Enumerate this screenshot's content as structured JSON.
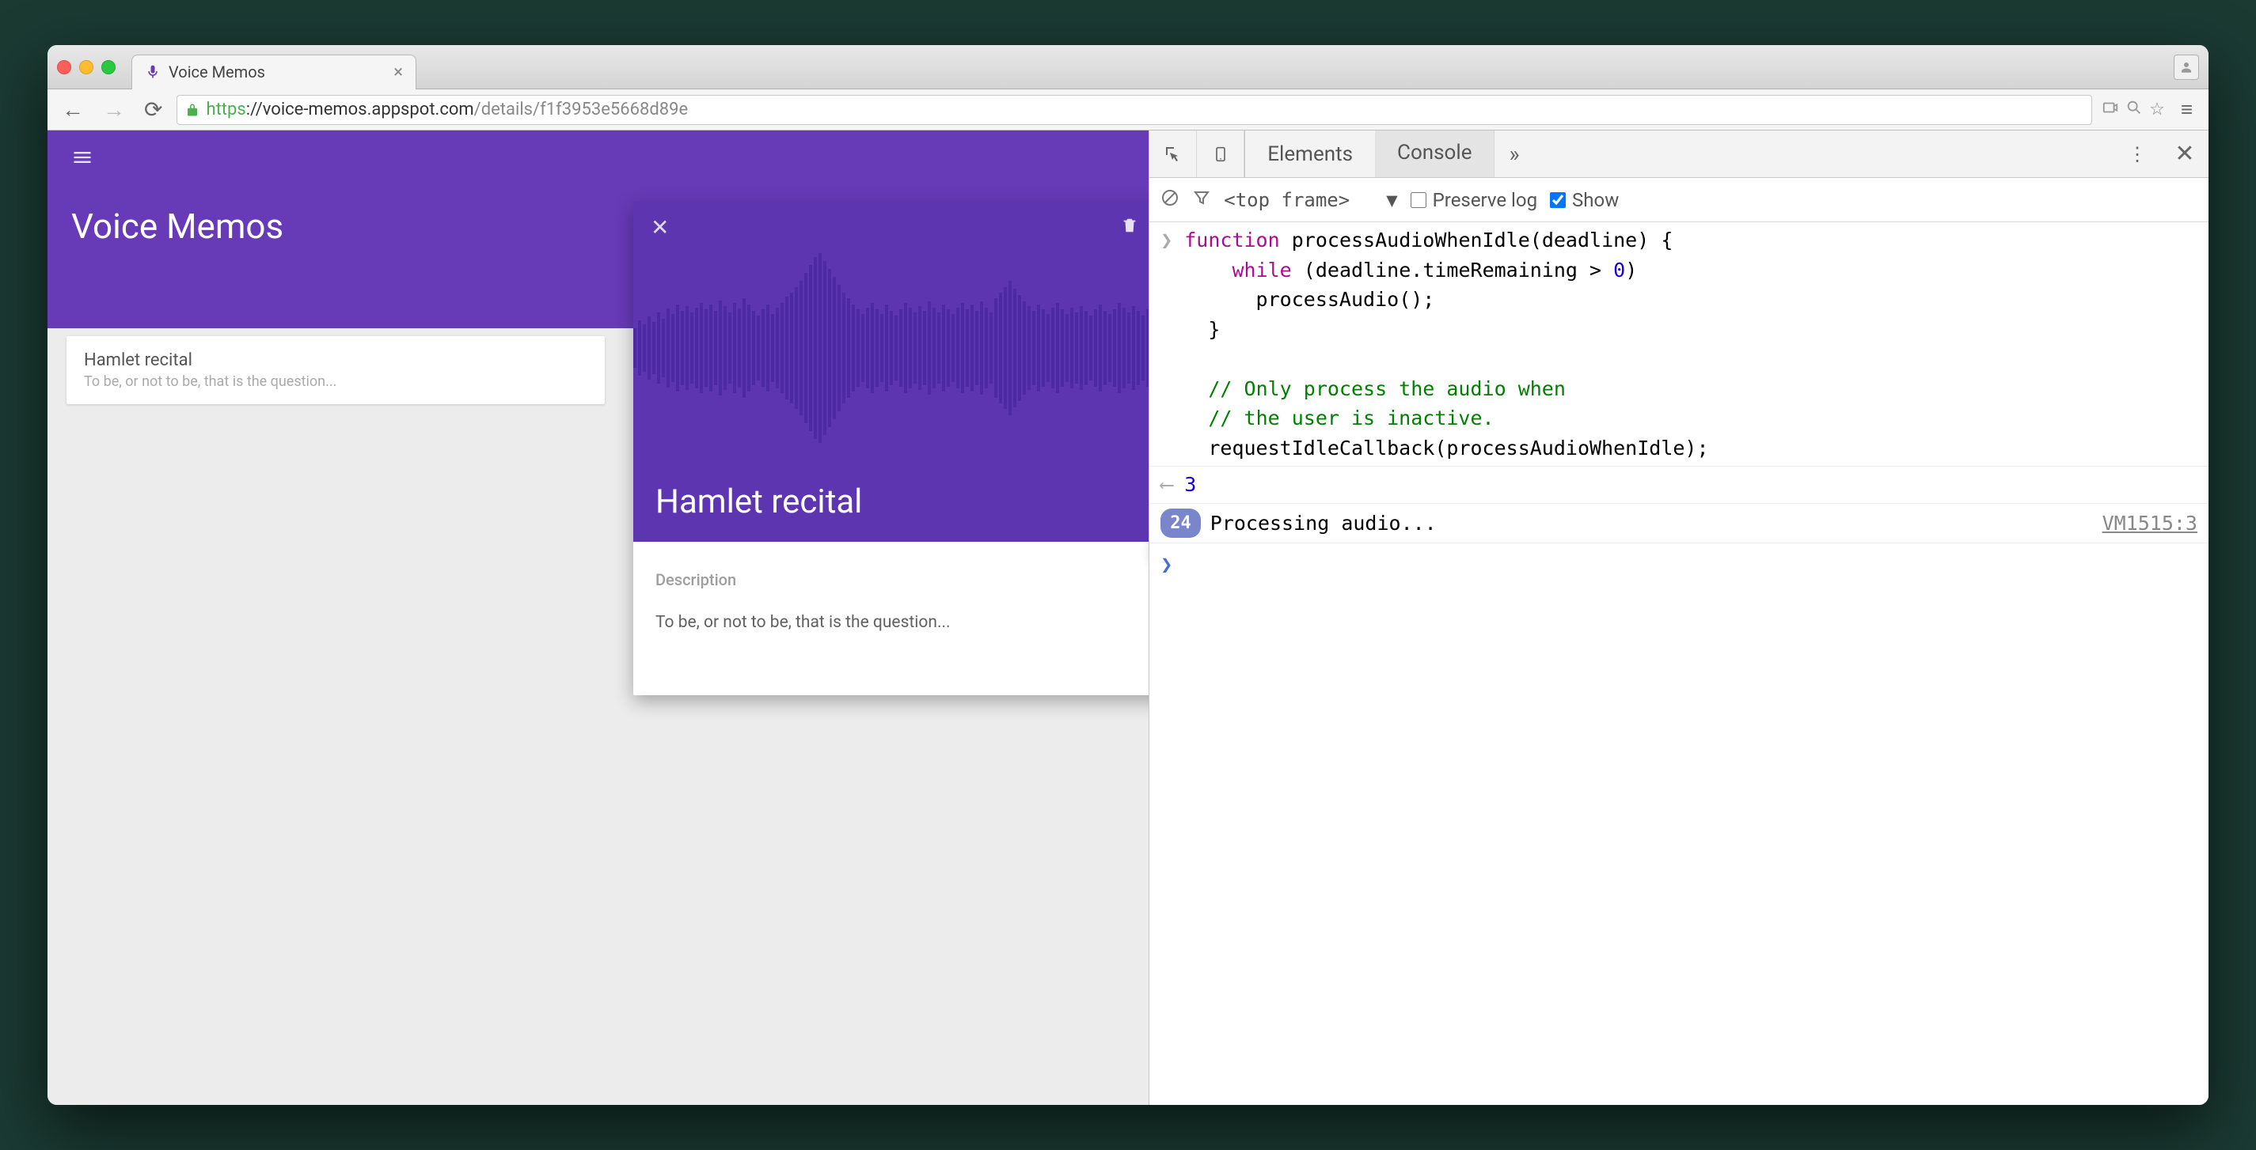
{
  "browser": {
    "tab_title": "Voice Memos",
    "url_secure": "https",
    "url_host": "://voice-memos.appspot.com",
    "url_path": "/details/f1f3953e5668d89e"
  },
  "app": {
    "title": "Voice Memos",
    "memo_list": [
      {
        "title": "Hamlet recital",
        "subtitle": "To be, or not to be, that is the question..."
      }
    ],
    "detail": {
      "title": "Hamlet recital",
      "description_label": "Description",
      "description_text": "To be, or not to be, that is the question..."
    }
  },
  "devtools": {
    "tabs": {
      "elements": "Elements",
      "console": "Console",
      "more": "»"
    },
    "filter": {
      "frame": "<top frame>",
      "preserve_log_label": "Preserve log",
      "show_label": "Show"
    },
    "console": {
      "code": "function processAudioWhenIdle(deadline) {\n    while (deadline.timeRemaining > 0)\n      processAudio();\n  }\n\n  // Only process the audio when\n  // the user is inactive.\n  requestIdleCallback(processAudioWhenIdle);",
      "return_value": "3",
      "log_count": "24",
      "log_text": "Processing audio...",
      "log_source": "VM1515:3"
    }
  }
}
